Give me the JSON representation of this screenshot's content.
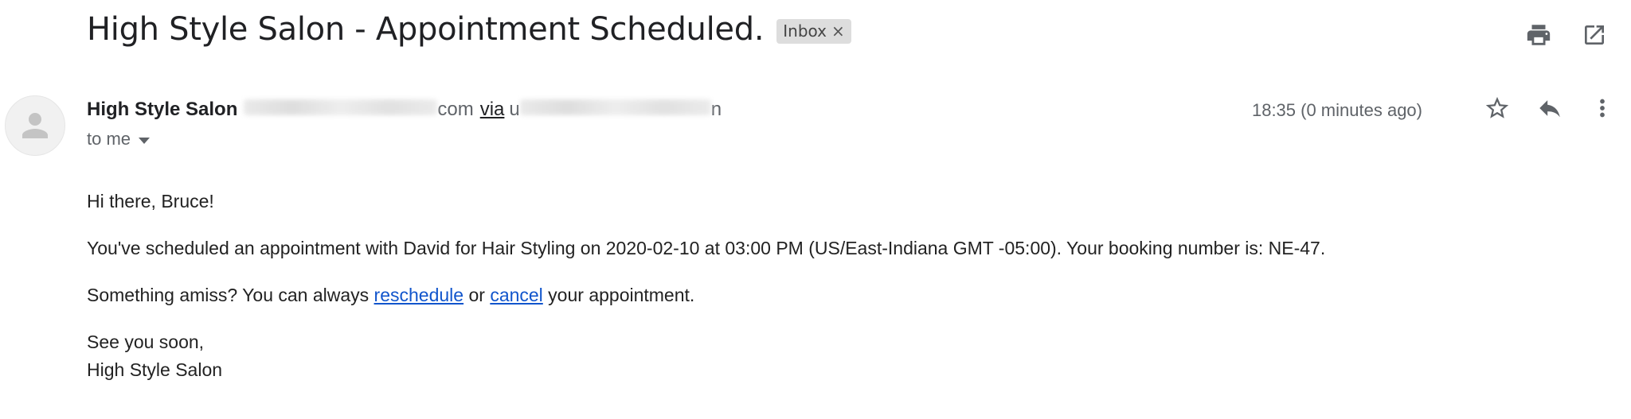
{
  "email": {
    "subject": "High Style Salon - Appointment Scheduled.",
    "label": "Inbox",
    "label_close": "×",
    "sender_name": "High Style Salon",
    "sender_email_tail": "com",
    "via_text": "via",
    "via_domain_start": "u",
    "via_domain_end": "n",
    "recipient": "to me",
    "timestamp": "18:35 (0 minutes ago)"
  },
  "body": {
    "greeting": "Hi there, Bruce!",
    "main_line": "You've scheduled an appointment with David for Hair Styling on 2020-02-10 at 03:00 PM (US/East-Indiana GMT -05:00). Your booking number is: NE-47.",
    "amiss_prefix": "Something amiss? You can always ",
    "reschedule_link": "reschedule",
    "or_text": " or ",
    "cancel_link": "cancel",
    "amiss_suffix": " your appointment.",
    "signoff": "See you soon,",
    "signature": "High Style Salon"
  },
  "icons": {
    "print": "print-icon",
    "open_new_window": "open-in-new-window-icon",
    "star": "star-icon",
    "reply": "reply-icon",
    "more": "more-vert-icon",
    "avatar": "person-icon"
  },
  "colors": {
    "link": "#1155cc",
    "chip_bg": "#dddddd",
    "muted_text": "#5f6368"
  }
}
